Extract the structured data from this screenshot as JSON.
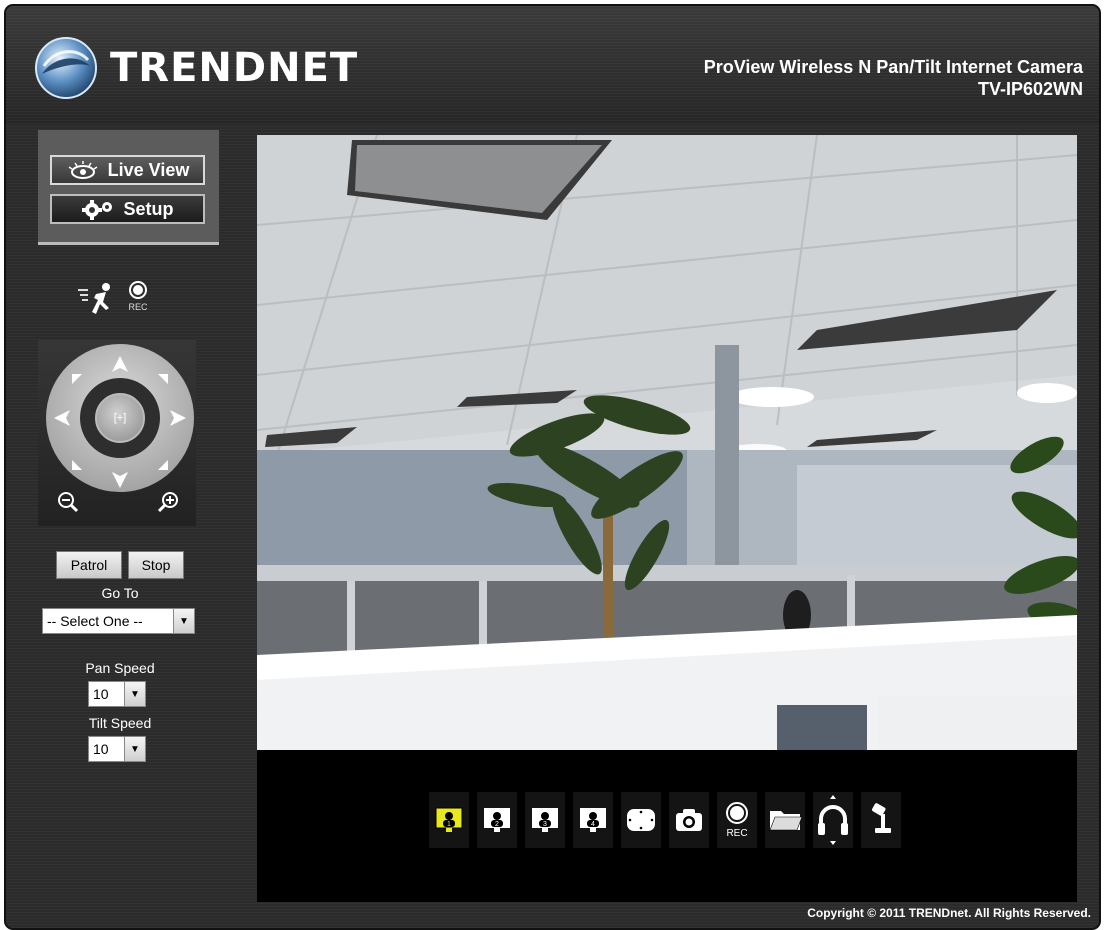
{
  "header": {
    "brand": "TRENDNET",
    "product_line1": "ProView Wireless N Pan/Tilt Internet Camera",
    "product_line2": "TV-IP602WN"
  },
  "nav": {
    "live_view": "Live View",
    "setup": "Setup"
  },
  "quick": {
    "rec_label": "REC"
  },
  "ptz": {
    "center_label": "[+]"
  },
  "patrol": {
    "patrol_label": "Patrol",
    "stop_label": "Stop",
    "goto_label": "Go To",
    "goto_selected": "-- Select One --"
  },
  "speed": {
    "pan_label": "Pan Speed",
    "pan_value": "10",
    "tilt_label": "Tilt Speed",
    "tilt_value": "10"
  },
  "toolbar": {
    "items": [
      {
        "name": "view-1-icon",
        "label": "1",
        "active": true
      },
      {
        "name": "view-2-icon",
        "label": "2",
        "active": false
      },
      {
        "name": "view-3-icon",
        "label": "3",
        "active": false
      },
      {
        "name": "view-4-icon",
        "label": "4",
        "active": false
      },
      {
        "name": "fullscreen-icon",
        "label": "",
        "active": false
      },
      {
        "name": "snapshot-icon",
        "label": "",
        "active": false
      },
      {
        "name": "record-icon",
        "label": "REC",
        "active": false
      },
      {
        "name": "folder-icon",
        "label": "",
        "active": false
      },
      {
        "name": "headphones-icon",
        "label": "",
        "active": false
      },
      {
        "name": "microphone-icon",
        "label": "",
        "active": false
      }
    ]
  },
  "footer": {
    "copyright": "Copyright © 2011 TRENDnet. All Rights Reserved."
  },
  "colors": {
    "background": "#2b2b2b",
    "active_view": "#e8e81a",
    "video_frame": "#000000"
  }
}
